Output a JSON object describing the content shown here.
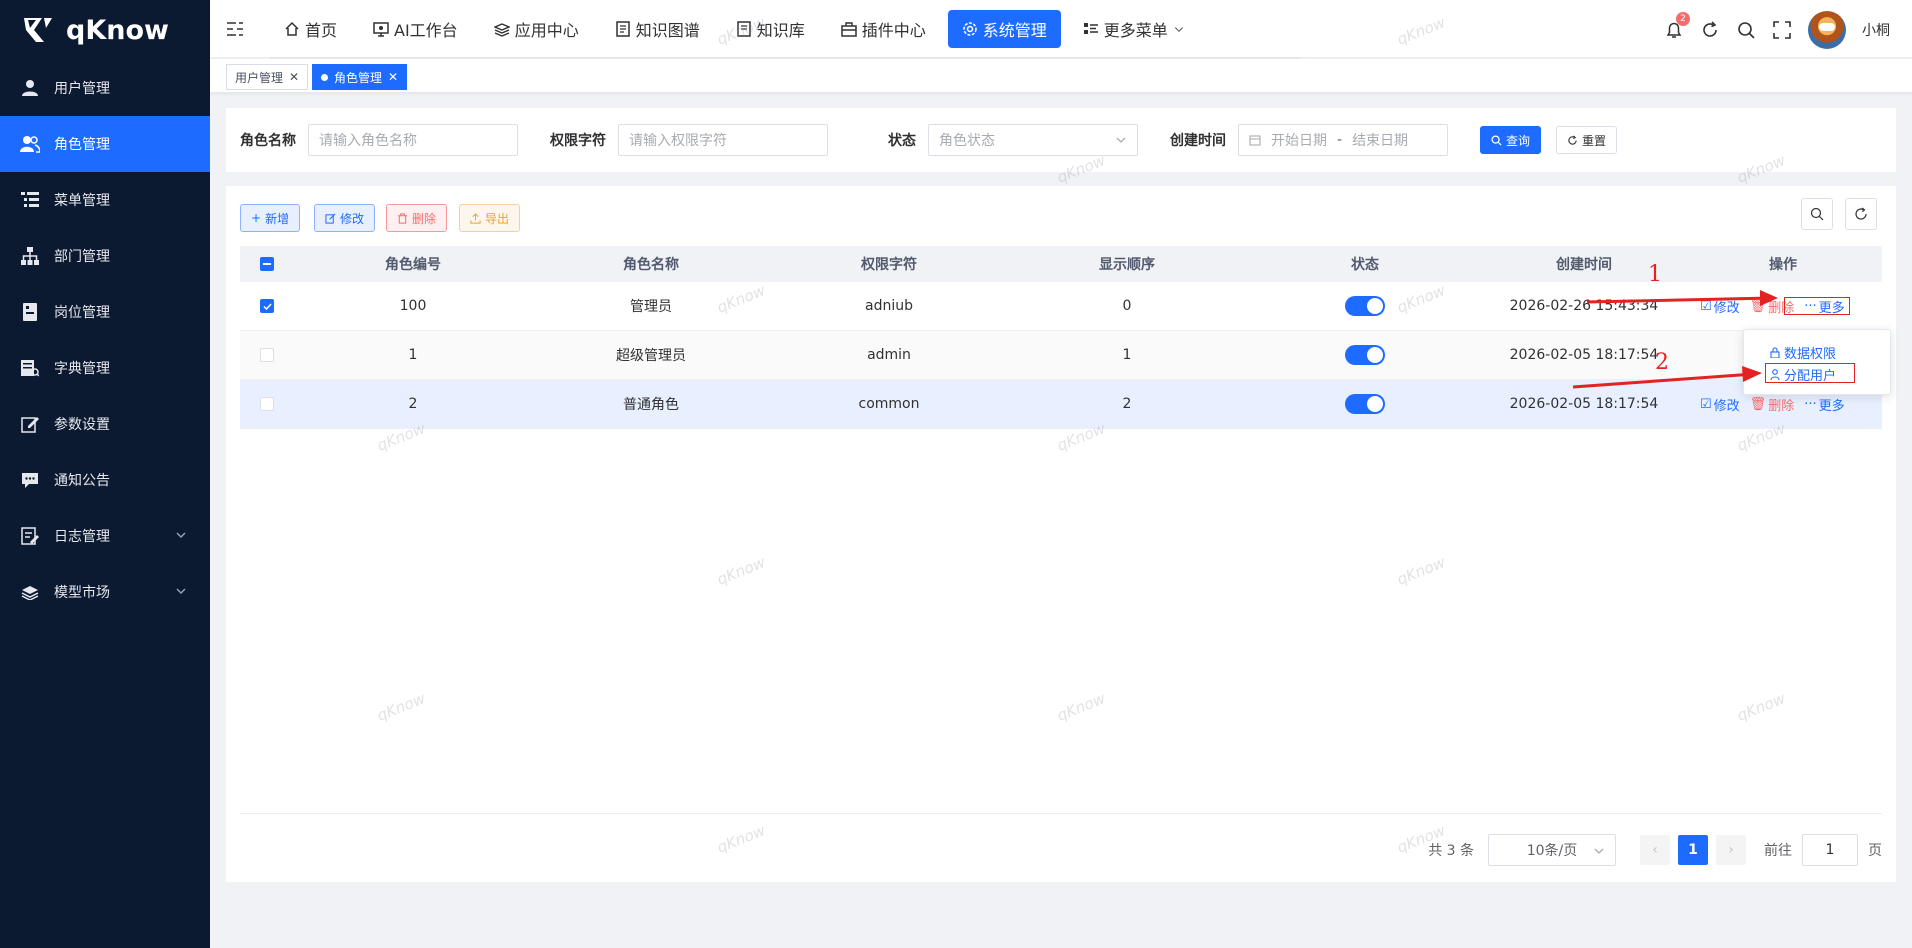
{
  "app": {
    "logo_text": "qKnow",
    "user_name": "小桐",
    "notif_count": "2"
  },
  "sidebar": {
    "items": [
      {
        "label": "用户管理",
        "icon": "user-icon"
      },
      {
        "label": "角色管理",
        "icon": "role-icon",
        "active": true
      },
      {
        "label": "菜单管理",
        "icon": "menu-list-icon"
      },
      {
        "label": "部门管理",
        "icon": "tree-icon"
      },
      {
        "label": "岗位管理",
        "icon": "post-icon"
      },
      {
        "label": "字典管理",
        "icon": "dict-icon"
      },
      {
        "label": "参数设置",
        "icon": "edit-icon"
      },
      {
        "label": "通知公告",
        "icon": "message-icon"
      },
      {
        "label": "日志管理",
        "icon": "log-icon",
        "expandable": true
      },
      {
        "label": "模型市场",
        "icon": "model-icon",
        "expandable": true
      }
    ]
  },
  "topnav": {
    "items": [
      {
        "label": "首页",
        "icon": "home-icon"
      },
      {
        "label": "AI工作台",
        "icon": "monitor-icon"
      },
      {
        "label": "应用中心",
        "icon": "app-icon"
      },
      {
        "label": "知识图谱",
        "icon": "graph-icon"
      },
      {
        "label": "知识库",
        "icon": "book-icon"
      },
      {
        "label": "插件中心",
        "icon": "plugin-icon"
      },
      {
        "label": "系统管理",
        "icon": "gear-icon",
        "active": true
      },
      {
        "label": "更多菜单",
        "icon": "more-menu-icon"
      }
    ]
  },
  "tags": [
    {
      "label": "用户管理",
      "active": false
    },
    {
      "label": "角色管理",
      "active": true
    }
  ],
  "search": {
    "role_name_label": "角色名称",
    "role_name_placeholder": "请输入角色名称",
    "role_key_label": "权限字符",
    "role_key_placeholder": "请输入权限字符",
    "status_label": "状态",
    "status_placeholder": "角色状态",
    "time_label": "创建时间",
    "start_placeholder": "开始日期",
    "range_sep": "-",
    "end_placeholder": "结束日期",
    "query_label": "查询",
    "reset_label": "重置"
  },
  "toolbar": {
    "add_label": "新增",
    "edit_label": "修改",
    "delete_label": "删除",
    "export_label": "导出"
  },
  "table": {
    "columns": [
      "角色编号",
      "角色名称",
      "权限字符",
      "显示顺序",
      "状态",
      "创建时间",
      "操作"
    ],
    "rows": [
      {
        "id": "100",
        "name": "管理员",
        "key": "adniub",
        "sort": "0",
        "enabled": true,
        "created": "2026-02-26 15:43:34",
        "checked": true
      },
      {
        "id": "1",
        "name": "超级管理员",
        "key": "admin",
        "sort": "1",
        "enabled": true,
        "created": "2026-02-05 18:17:54",
        "checked": false
      },
      {
        "id": "2",
        "name": "普通角色",
        "key": "common",
        "sort": "2",
        "enabled": true,
        "created": "2026-02-05 18:17:54",
        "checked": false
      }
    ],
    "op_edit": "修改",
    "op_delete": "删除",
    "op_more": "更多"
  },
  "more_menu": {
    "data_scope": "数据权限",
    "assign_user": "分配用户"
  },
  "pagination": {
    "total": "共 3 条",
    "page_size": "10条/页",
    "current": "1",
    "goto_label": "前往",
    "goto_value": "1",
    "page_unit": "页"
  },
  "annotations": {
    "step1": "1",
    "step2": "2"
  },
  "watermark": "qKnow",
  "colors": {
    "primary": "#1e6bff",
    "sidebar_bg": "#0c1a31",
    "danger": "#f56c6c",
    "warning": "#e6a23c",
    "annotation": "#e52222"
  }
}
